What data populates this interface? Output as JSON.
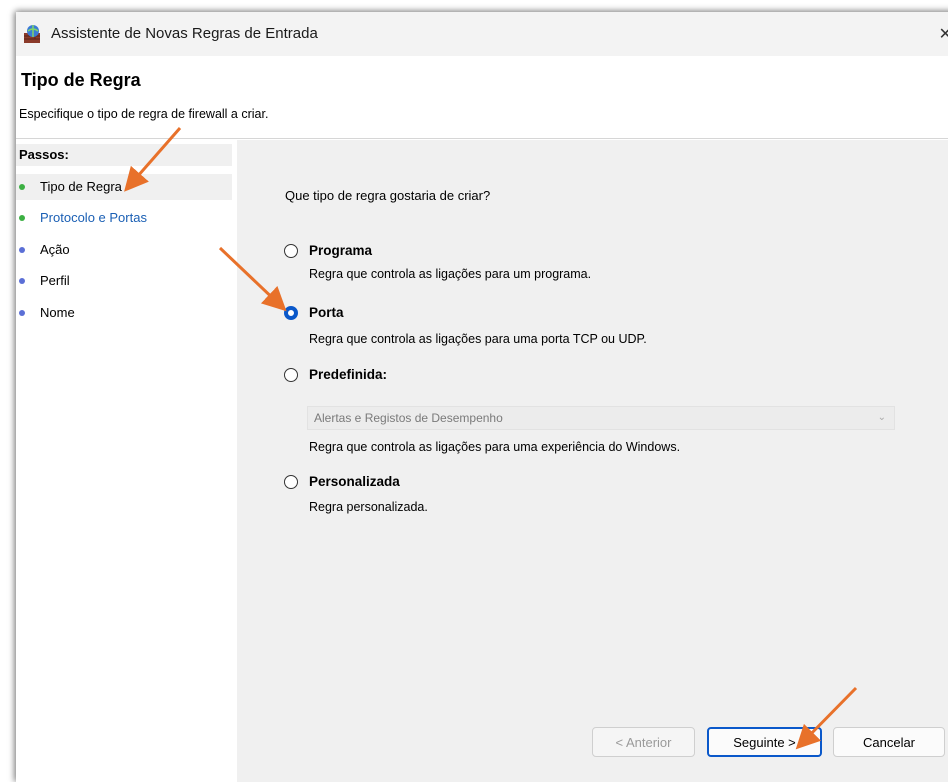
{
  "window": {
    "title": "Assistente de Novas Regras de Entrada",
    "close_glyph": "✕"
  },
  "header": {
    "title": "Tipo de Regra",
    "subtitle": "Especifique o tipo de regra de firewall a criar."
  },
  "steps": {
    "heading": "Passos:",
    "items": [
      {
        "label": "Tipo de Regra",
        "dot_color": "#3cb043"
      },
      {
        "label": "Protocolo e Portas",
        "dot_color": "#3cb043"
      },
      {
        "label": "Ação",
        "dot_color": "#5b6fd6"
      },
      {
        "label": "Perfil",
        "dot_color": "#5b6fd6"
      },
      {
        "label": "Nome",
        "dot_color": "#5b6fd6"
      }
    ]
  },
  "content": {
    "question": "Que tipo de regra gostaria de criar?",
    "options": [
      {
        "label": "Programa",
        "description": "Regra que controla as ligações para um programa.",
        "checked": false
      },
      {
        "label": "Porta",
        "description": "Regra que controla as ligações para uma porta TCP ou UDP.",
        "checked": true
      },
      {
        "label": "Predefinida:",
        "description": "Regra que controla as ligações para uma experiência do Windows.",
        "checked": false
      },
      {
        "label": "Personalizada",
        "description": "Regra personalizada.",
        "checked": false
      }
    ],
    "predefined_select": {
      "value": "Alertas e Registos de Desempenho",
      "chevron": "⌄"
    }
  },
  "buttons": {
    "back": "< Anterior",
    "next": "Seguinte >",
    "cancel": "Cancelar"
  },
  "colors": {
    "accent": "#0a58ca",
    "annotation_arrow": "#e8712a"
  }
}
